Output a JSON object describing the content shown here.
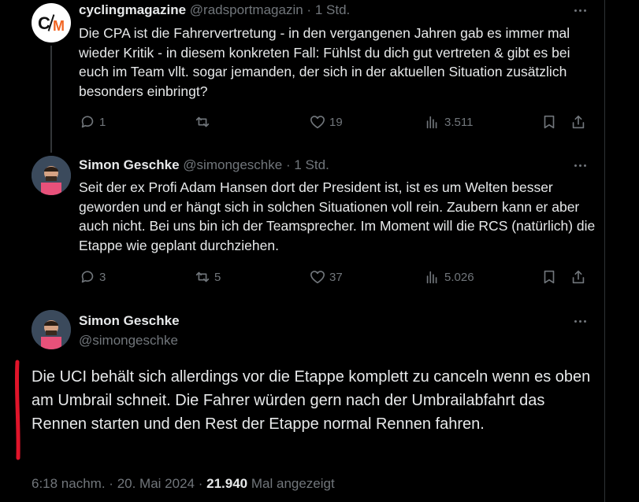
{
  "tweets": [
    {
      "name": "cyclingmagazine",
      "handle": "@radsportmagazin",
      "sep": "·",
      "time": "1 Std.",
      "avatar_text": "CM",
      "text": "Die CPA ist die Fahrervertretung - in den vergangenen Jahren gab es immer mal wieder Kritik - in diesem konkreten Fall: Fühlst du dich gut vertreten & gibt es bei euch im Team vllt. sogar jemanden, der sich in der aktuellen Situation zusätzlich besonders einbringt?",
      "replies": "1",
      "retweets": "",
      "likes": "19",
      "views": "3.511"
    },
    {
      "name": "Simon Geschke",
      "handle": "@simongeschke",
      "sep": "·",
      "time": "1 Std.",
      "text": "Seit der ex Profi Adam Hansen dort der President ist, ist es um Welten besser geworden und er hängt sich in solchen Situationen voll rein. Zaubern kann er aber auch nicht. Bei uns bin ich der Teamsprecher. Im Moment will die RCS (natürlich) die Etappe wie geplant durchziehen.",
      "replies": "3",
      "retweets": "5",
      "likes": "37",
      "views": "5.026"
    }
  ],
  "main_tweet": {
    "name": "Simon Geschke",
    "handle": "@simongeschke",
    "text": "Die UCI behält sich allerdings vor die Etappe komplett zu canceln wenn es oben am Umbrail schneit. Die Fahrer würden gern nach der Umbrailabfahrt das Rennen starten und den Rest der Etappe normal Rennen fahren.",
    "time": "6:18 nachm.",
    "sep": "·",
    "date": "20. Mai 2024",
    "views": "21.940",
    "views_label": "Mal angezeigt"
  },
  "colors": {
    "background": "#000000",
    "text": "#e7e9ea",
    "muted": "#71767b",
    "divider": "#2f3336",
    "annotation_red": "#e0142a",
    "logo_orange": "#f26522"
  }
}
